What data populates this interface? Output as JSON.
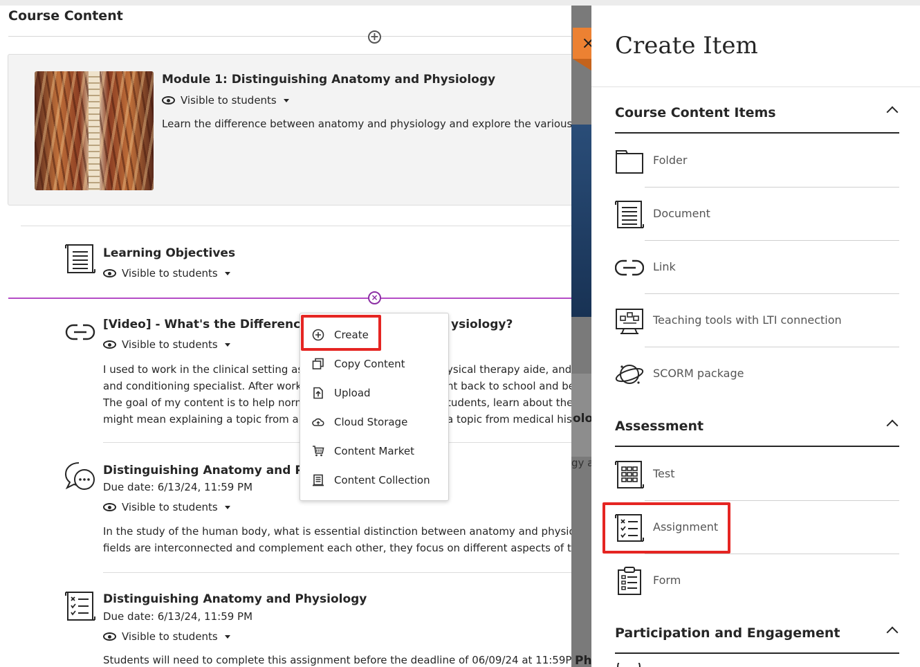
{
  "course": {
    "title": "Course Content",
    "module": {
      "title": "Module 1: Distinguishing Anatomy and Physiology",
      "visibility": "Visible to students",
      "description": "Learn the difference between anatomy and physiology and explore the various l"
    },
    "items": [
      {
        "title": "Learning Objectives",
        "visibility": "Visible to students",
        "icon": "document-icon"
      },
      {
        "title_left": "[Video] - What's the Difference B",
        "title_right": "ysiology?",
        "visibility": "Visible to students",
        "icon": "link-icon",
        "body_left": [
          "I used to work in the clinical setting as",
          "and conditioning specialist. After worki",
          "The goal of my content is to help norm",
          "might mean explaining a topic from an"
        ],
        "body_right": [
          "ysical therapy aide, and",
          "nt back to school and be",
          "tudents, learn about the",
          "a topic from medical histolo"
        ]
      },
      {
        "title": "Distinguishing Anatomy and Phy",
        "due": "Due date: 6/13/24, 11:59 PM",
        "visibility": "Visible to students",
        "icon": "discussion-icon",
        "body": [
          "In the study of the human body, what is essential distinction between anatomy and physiol",
          "fields are interconnected and complement each other, they focus on different aspects of th"
        ]
      },
      {
        "title": "Distinguishing Anatomy and Physiology",
        "due": "Due date: 6/13/24, 11:59 PM",
        "visibility": "Visible to students",
        "icon": "assignment-icon",
        "body": [
          "Students will need to complete this assignment before the deadline of 06/09/24 at 11:59PM"
        ]
      }
    ],
    "behind_text": {
      "gy": "gy a",
      "ph": "Ph"
    }
  },
  "context_menu": {
    "items": [
      {
        "label": "Create",
        "icon": "plus-circle-icon"
      },
      {
        "label": "Copy Content",
        "icon": "copy-icon"
      },
      {
        "label": "Upload",
        "icon": "upload-icon"
      },
      {
        "label": "Cloud Storage",
        "icon": "cloud-icon"
      },
      {
        "label": "Content Market",
        "icon": "cart-icon"
      },
      {
        "label": "Content Collection",
        "icon": "collection-icon"
      }
    ]
  },
  "panel": {
    "close": "×",
    "title": "Create Item",
    "sections": [
      {
        "label": "Course Content Items",
        "options": [
          {
            "label": "Folder",
            "icon": "folder-icon"
          },
          {
            "label": "Document",
            "icon": "document-icon"
          },
          {
            "label": "Link",
            "icon": "link-icon"
          },
          {
            "label": "Teaching tools with LTI connection",
            "icon": "lti-icon"
          },
          {
            "label": "SCORM package",
            "icon": "scorm-icon"
          }
        ]
      },
      {
        "label": "Assessment",
        "options": [
          {
            "label": "Test",
            "icon": "test-icon"
          },
          {
            "label": "Assignment",
            "icon": "assignment-icon"
          },
          {
            "label": "Form",
            "icon": "form-icon"
          }
        ]
      },
      {
        "label": "Participation and Engagement",
        "options": []
      }
    ]
  },
  "colors": {
    "accent_orange": "#ec8132",
    "highlight_red": "#e52522",
    "insert_purple": "#b44bc6"
  }
}
